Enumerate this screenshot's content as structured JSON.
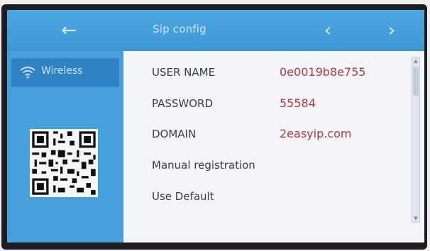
{
  "header": {
    "title": "Sip config",
    "back_icon": "arrow-left-icon",
    "prev_icon": "chevron-left-icon",
    "next_icon": "chevron-right-icon"
  },
  "sidebar": {
    "items": [
      {
        "label": "Wireless",
        "icon": "wifi-icon",
        "selected": true
      }
    ],
    "qr_icon": "qr-code-icon"
  },
  "sip": {
    "user_name_label": "USER NAME",
    "user_name_value": "0e0019b8e755",
    "password_label": "PASSWORD",
    "password_value": "55584",
    "domain_label": "DOMAIN",
    "domain_value": "2easyip.com",
    "manual_registration_label": "Manual registration",
    "use_default_label": "Use Default"
  },
  "colors": {
    "header": "#45a0dc",
    "sidebar_selected": "#2f83c4",
    "value_text": "#b53a3e",
    "panel": "#f3f5f8"
  }
}
